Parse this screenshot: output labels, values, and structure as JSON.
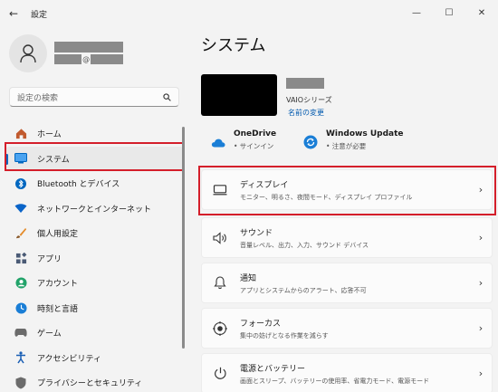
{
  "window": {
    "title": "設定",
    "back": "←",
    "minimize": "—",
    "maximize": "☐",
    "close": "✕"
  },
  "user": {
    "email_at": "@"
  },
  "search": {
    "placeholder": "設定の検索",
    "icon": "search-icon"
  },
  "sidebar": {
    "items": [
      {
        "label": "ホーム",
        "icon": "home-icon",
        "color": "#c15a2e"
      },
      {
        "label": "システム",
        "icon": "system-monitor-icon",
        "color": "#0078d4",
        "active": true
      },
      {
        "label": "Bluetooth とデバイス",
        "icon": "bluetooth-icon",
        "color": "#0067c0"
      },
      {
        "label": "ネットワークとインターネット",
        "icon": "wifi-icon",
        "color": "#0a64c8"
      },
      {
        "label": "個人用設定",
        "icon": "brush-icon",
        "color": "#e48b2a"
      },
      {
        "label": "アプリ",
        "icon": "apps-icon",
        "color": "#4a5a75"
      },
      {
        "label": "アカウント",
        "icon": "account-icon",
        "color": "#22a36a"
      },
      {
        "label": "時刻と言語",
        "icon": "clock-globe-icon",
        "color": "#1a7ed6"
      },
      {
        "label": "ゲーム",
        "icon": "gamepad-icon",
        "color": "#6b6b6b"
      },
      {
        "label": "アクセシビリティ",
        "icon": "accessibility-icon",
        "color": "#1a5fb4"
      },
      {
        "label": "プライバシーとセキュリティ",
        "icon": "shield-icon",
        "color": "#6b6b6b"
      }
    ]
  },
  "main": {
    "title": "システム",
    "device": {
      "model": "VAIOシリーズ",
      "rename": "名前の変更"
    },
    "quick": [
      {
        "title": "OneDrive",
        "sub": "• サインイン",
        "icon": "cloud-icon"
      },
      {
        "title": "Windows Update",
        "sub": "• 注意が必要",
        "icon": "sync-icon"
      }
    ],
    "cards": [
      {
        "title": "ディスプレイ",
        "sub": "モニター、明るさ、夜間モード、ディスプレイ プロファイル",
        "icon": "display-icon"
      },
      {
        "title": "サウンド",
        "sub": "音量レベル、出力、入力、サウンド デバイス",
        "icon": "speaker-icon"
      },
      {
        "title": "通知",
        "sub": "アプリとシステムからのアラート、応答不可",
        "icon": "bell-icon"
      },
      {
        "title": "フォーカス",
        "sub": "集中の妨げとなる作業を減らす",
        "icon": "focus-icon"
      },
      {
        "title": "電源とバッテリー",
        "sub": "画面とスリープ、バッテリーの使用率、省電力モード、電源モード",
        "icon": "power-icon"
      }
    ],
    "chevron": "›"
  },
  "colors": {
    "accent": "#0067c0",
    "highlight": "#d41e2a"
  }
}
